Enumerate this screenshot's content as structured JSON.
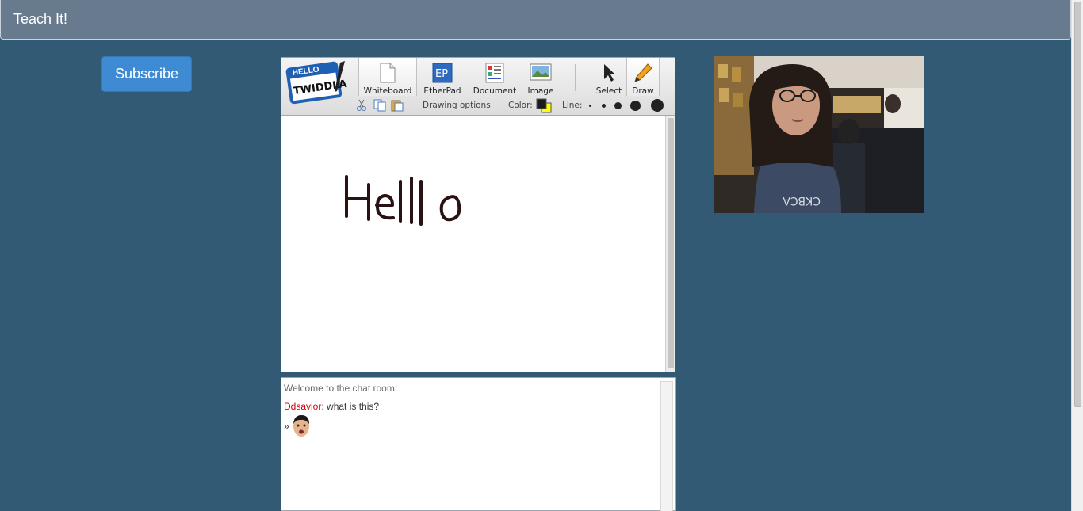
{
  "header": {
    "title": "Teach It!"
  },
  "subscribe": {
    "label": "Subscribe"
  },
  "twiddla": {
    "logo_text": "TWIDDLA",
    "logo_hello": "HELLO",
    "tools": [
      {
        "label": "Whiteboard",
        "icon": "page-icon"
      },
      {
        "label": "EtherPad",
        "icon": "etherpad-icon",
        "badge": "EP"
      },
      {
        "label": "Document",
        "icon": "document-icon"
      },
      {
        "label": "Image",
        "icon": "image-icon"
      },
      {
        "label": "Select",
        "icon": "pointer-icon"
      },
      {
        "label": "Draw",
        "icon": "pencil-icon"
      }
    ],
    "options": {
      "drawing_options": "Drawing options",
      "color_label": "Color:",
      "line_label": "Line:",
      "primary_color": "#1a1a1a",
      "secondary_color": "#ffff00"
    },
    "canvas_text": "Hell o"
  },
  "chat": {
    "welcome": "Welcome to the chat room!",
    "messages": [
      {
        "user": "Ddsavior",
        "text": ": what is this?"
      }
    ],
    "prompt": "»",
    "user_color": "#d40000"
  }
}
